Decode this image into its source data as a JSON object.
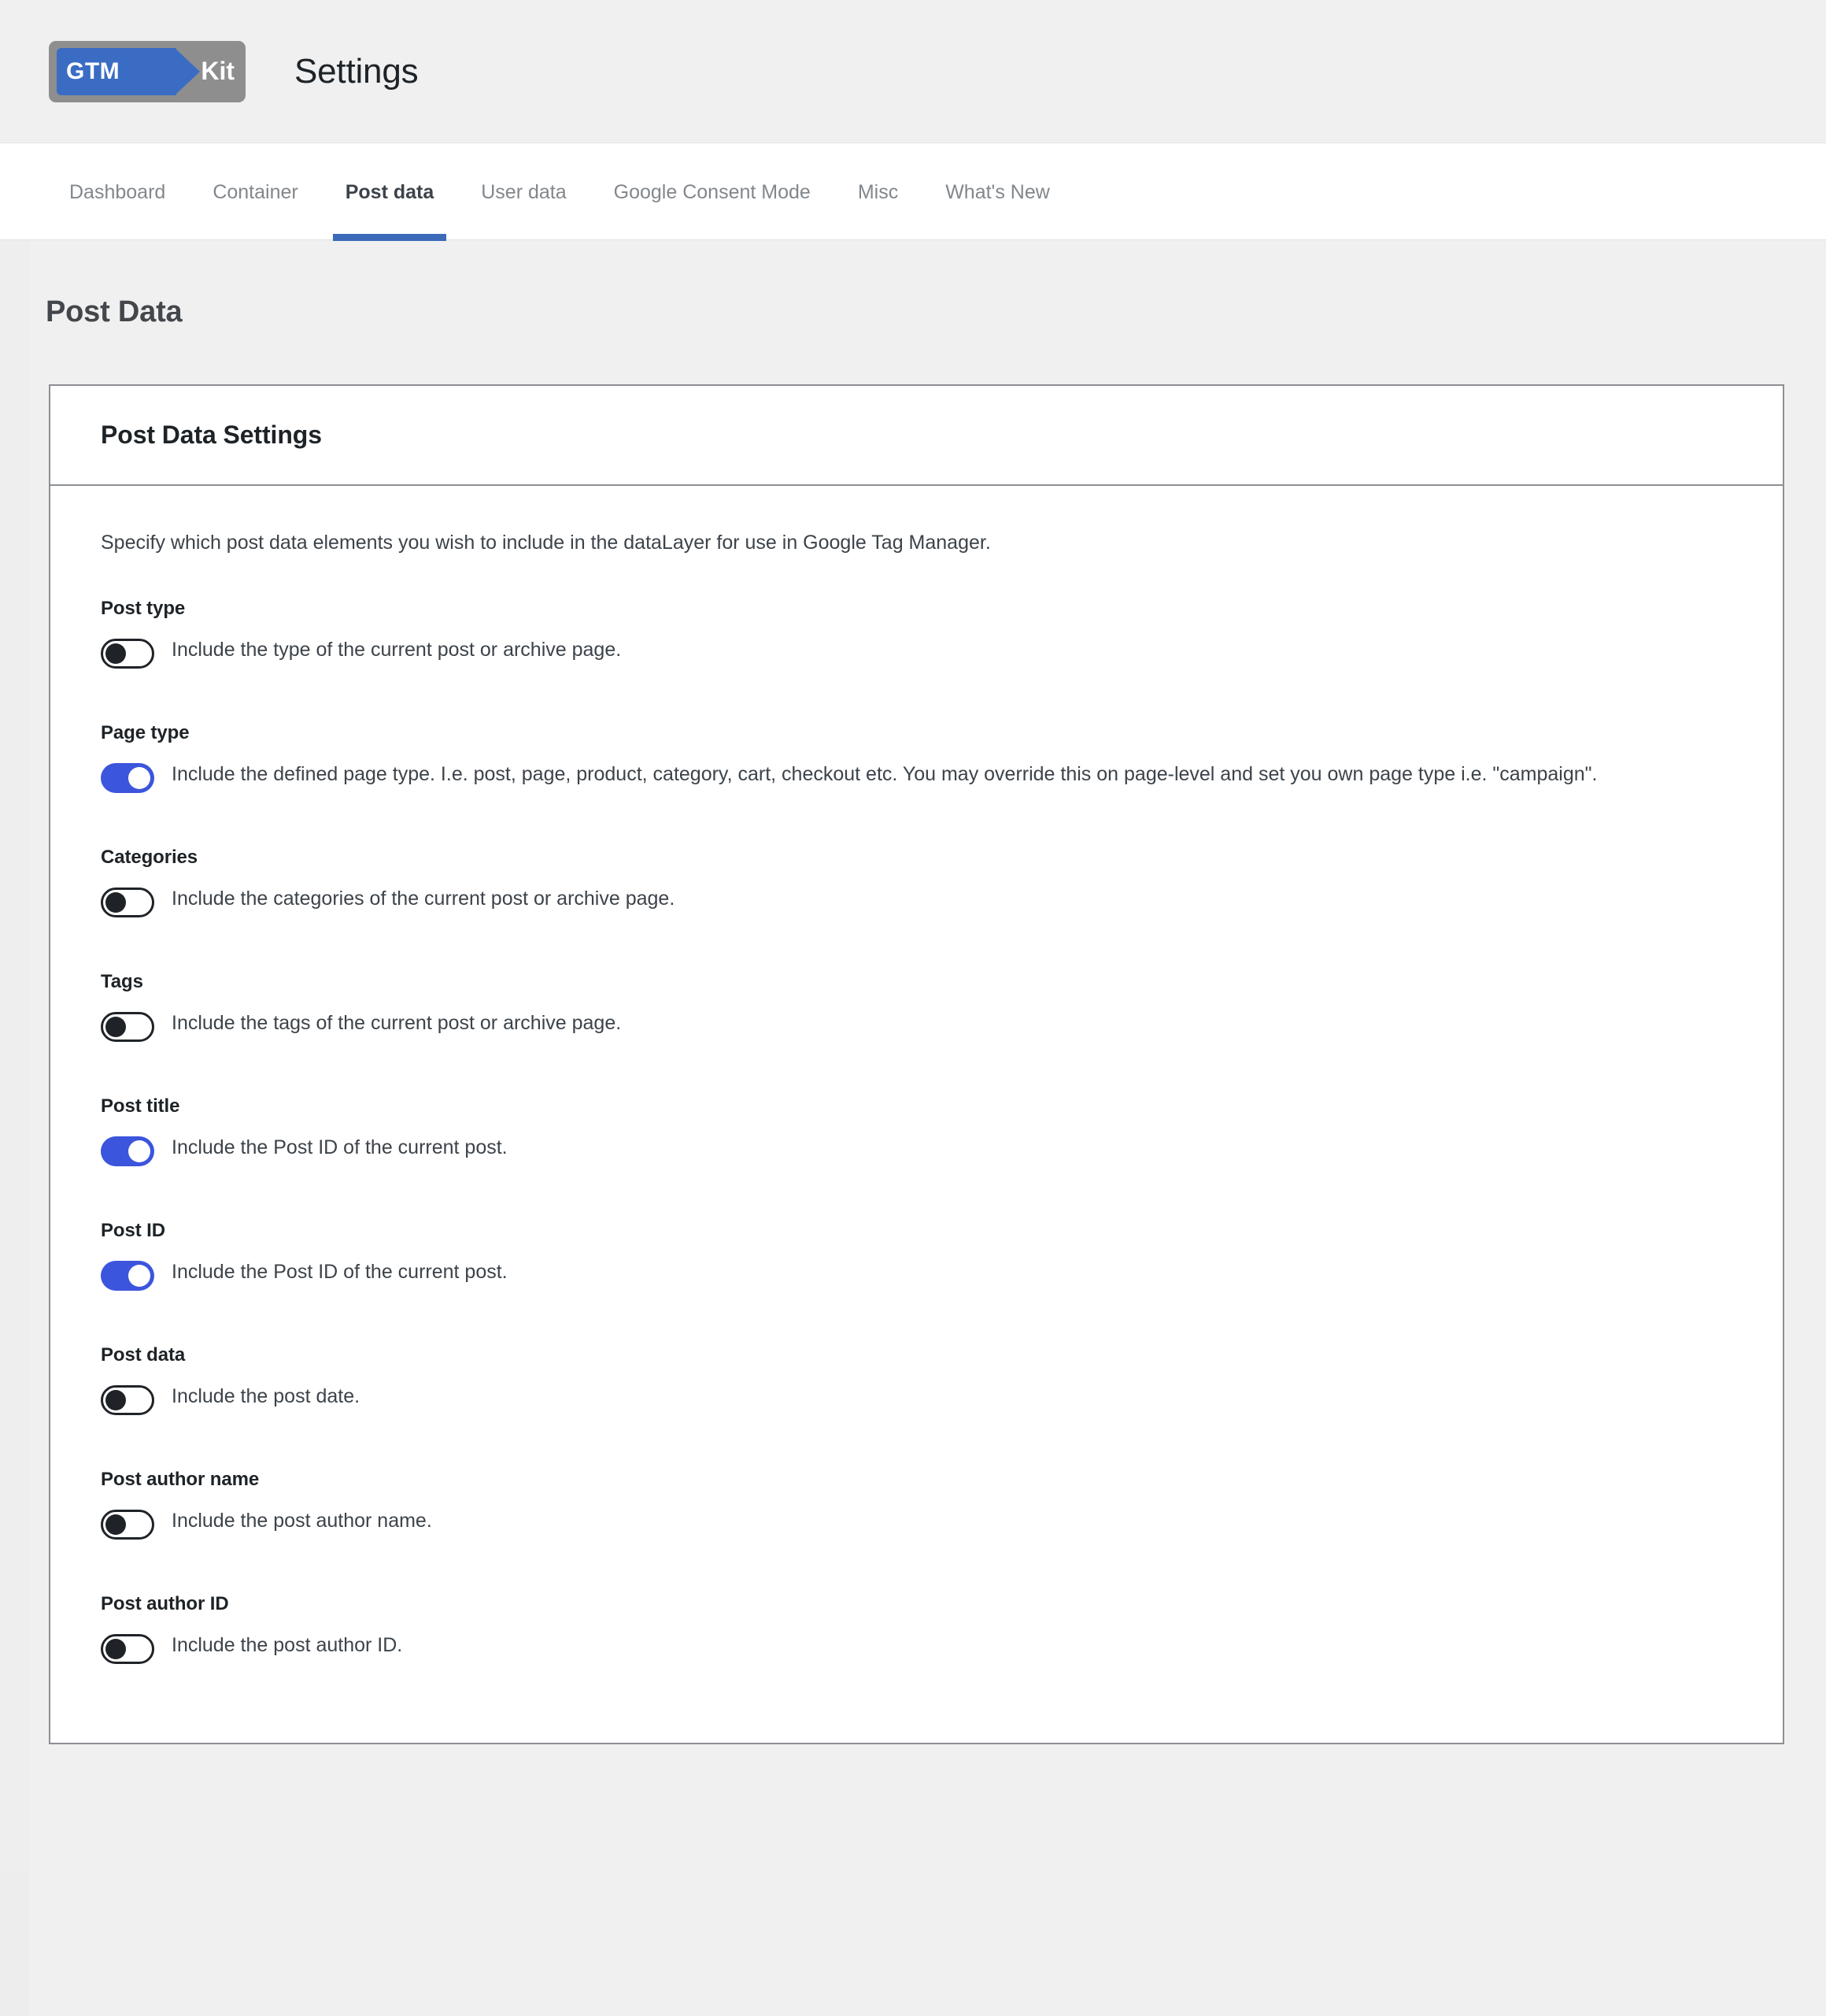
{
  "colors": {
    "accent_blue": "#3c55dd",
    "tab_underline": "#3a6ab8",
    "logo_blue": "#3a6cc4",
    "logo_grey": "#8e8e8e",
    "page_background": "#f0f0f1",
    "card_border": "#8c8f94"
  },
  "header": {
    "logo_gtm_text": "GTM",
    "logo_kit_text": "Kit",
    "title": "Settings"
  },
  "tabs": [
    {
      "label": "Dashboard",
      "active": false
    },
    {
      "label": "Container",
      "active": false
    },
    {
      "label": "Post data",
      "active": true
    },
    {
      "label": "User data",
      "active": false
    },
    {
      "label": "Google Consent Mode",
      "active": false
    },
    {
      "label": "Misc",
      "active": false
    },
    {
      "label": "What's New",
      "active": false
    }
  ],
  "page": {
    "title": "Post Data"
  },
  "card": {
    "title": "Post Data Settings",
    "intro": "Specify which post data elements you wish to include in the dataLayer for use in Google Tag Manager.",
    "settings": [
      {
        "label": "Post type",
        "description": "Include the type of the current post or archive page.",
        "state": "off"
      },
      {
        "label": "Page type",
        "description": "Include the defined page type. I.e. post, page, product, category, cart, checkout etc. You may override this on page-level and set you own page type i.e. \"campaign\".",
        "state": "on"
      },
      {
        "label": "Categories",
        "description": "Include the categories of the current post or archive page.",
        "state": "off"
      },
      {
        "label": "Tags",
        "description": "Include the tags of the current post or archive page.",
        "state": "off"
      },
      {
        "label": "Post title",
        "description": "Include the Post ID of the current post.",
        "state": "on"
      },
      {
        "label": "Post ID",
        "description": "Include the Post ID of the current post.",
        "state": "on"
      },
      {
        "label": "Post data",
        "description": "Include the post date.",
        "state": "off"
      },
      {
        "label": "Post author name",
        "description": "Include the post author name.",
        "state": "off"
      },
      {
        "label": "Post author ID",
        "description": "Include the post author ID.",
        "state": "off"
      }
    ]
  }
}
